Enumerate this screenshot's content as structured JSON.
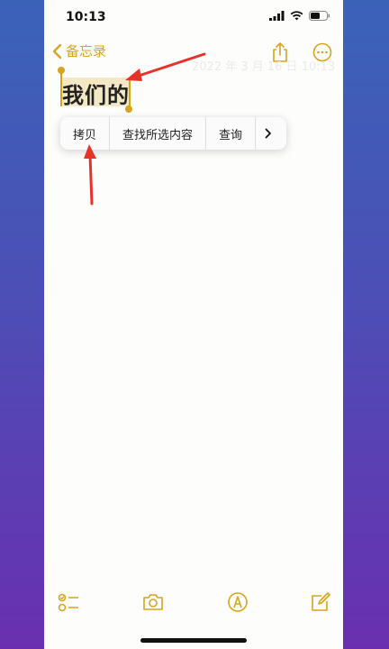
{
  "status_bar": {
    "time": "10:13"
  },
  "nav": {
    "back_label": "备忘录"
  },
  "note": {
    "title": "我们的",
    "ghost_text": "2022 年 3 月 16 日 10:13"
  },
  "context_menu": {
    "items": [
      "拷贝",
      "查找所选内容",
      "查询"
    ]
  },
  "colors": {
    "accent": "#d6a51c",
    "selection": "#f4e7c4",
    "annotation_arrow": "#e5332a"
  },
  "icons": {
    "share": "share-icon",
    "more": "ellipsis-circle-icon",
    "checklist": "checklist-icon",
    "camera": "camera-icon",
    "markup": "markup-pen-icon",
    "compose": "compose-icon"
  }
}
